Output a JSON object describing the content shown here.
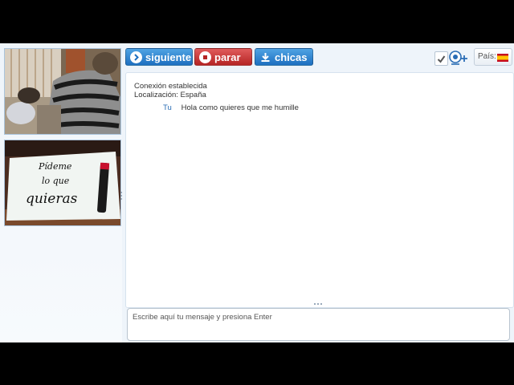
{
  "toolbar": {
    "next_label": "siguiente",
    "stop_label": "parar",
    "girls_label": "chicas",
    "country_label": "País:",
    "country_flag": "Spain",
    "colors": {
      "blue_button": "#1d6fc0",
      "red_button": "#b52424"
    }
  },
  "local_video": {
    "handwritten_text": "Pídeme lo que quieras"
  },
  "chat": {
    "system_lines": [
      "Conexión establecida",
      "Localización: España"
    ],
    "messages": [
      {
        "sender": "Tu",
        "text": "Hola como quieres que me humille"
      }
    ]
  },
  "input": {
    "placeholder": "Escribe aquí tu mensaje y presiona Enter"
  }
}
